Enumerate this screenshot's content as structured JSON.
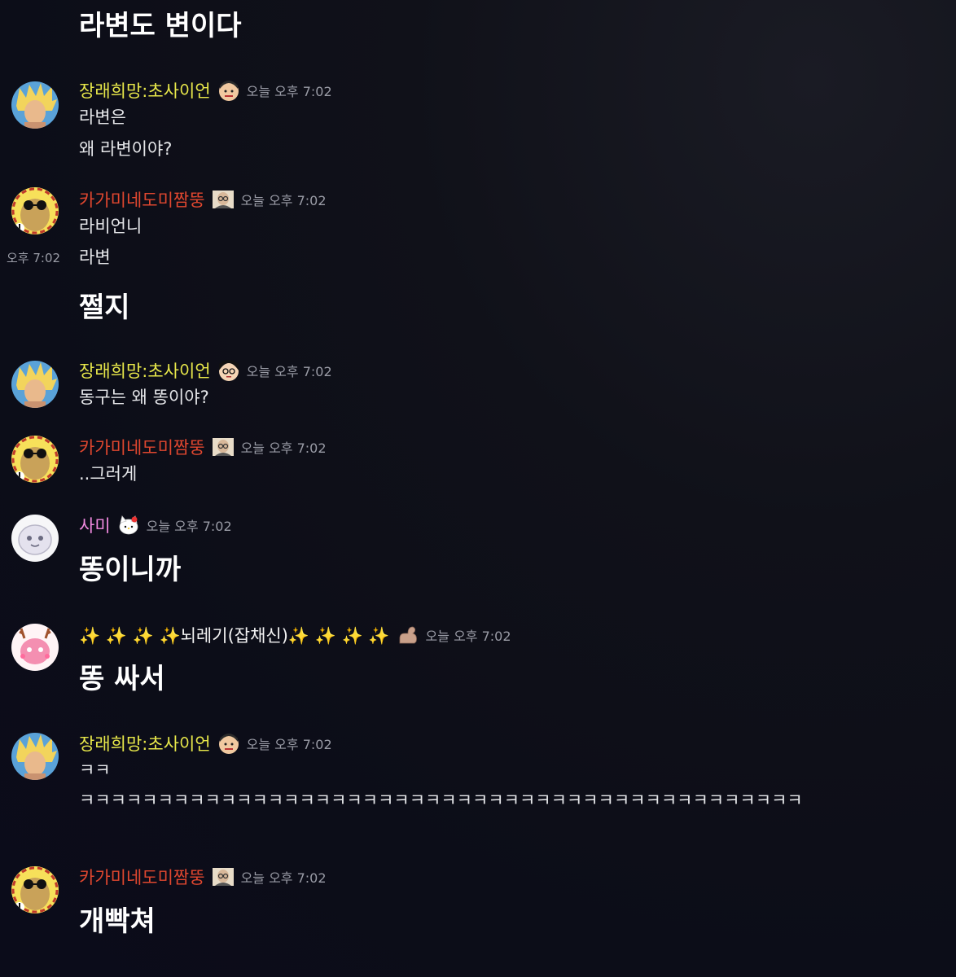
{
  "colors": {
    "saiyan": "#e8e84a",
    "kami": "#e0472f",
    "sami": "#f28ae0",
    "nwa": "#f4f4f4"
  },
  "messages": {
    "top_big": "라변도 변이다",
    "g1": {
      "user": "장래희망:초사이언",
      "badge": "boy-face-icon",
      "time": "오늘 오후 7:02",
      "lines": [
        "라변은",
        "왜 라변이야?"
      ]
    },
    "g2": {
      "user": "카가미네도미짬뚱",
      "badge": "old-man-glasses-icon",
      "time": "오늘 오후 7:02",
      "lines": [
        "라비언니",
        "라변"
      ],
      "side_time": "오후 7:02",
      "big": "쩔지"
    },
    "g3": {
      "user": "장래희망:초사이언",
      "badge": "nobita-face-icon",
      "time": "오늘 오후 7:02",
      "lines": [
        "동구는 왜 똥이야?"
      ]
    },
    "g4": {
      "user": "카가미네도미짬뚱",
      "badge": "old-man-glasses-icon",
      "time": "오늘 오후 7:02",
      "lines": [
        "..그러게"
      ]
    },
    "g5": {
      "user": "사미",
      "badge": "hello-kitty-icon",
      "time": "오늘 오후 7:02",
      "big": "똥이니까"
    },
    "g6": {
      "user": "✨ ✨ ✨ ✨뇌레기(잡채신)✨ ✨ ✨ ✨",
      "badge": "flexed-arm-icon",
      "time": "오늘 오후 7:02",
      "big": "똥 싸서"
    },
    "g7": {
      "user": "장래희망:초사이언",
      "badge": "boy-face-icon",
      "time": "오늘 오후 7:02",
      "lines": [
        "ㅋㅋ",
        "ㅋㅋㅋㅋㅋㅋㅋㅋㅋㅋㅋㅋㅋㅋㅋㅋㅋㅋㅋㅋㅋㅋㅋㅋㅋㅋㅋㅋㅋㅋㅋㅋㅋㅋㅋㅋㅋㅋㅋㅋㅋㅋㅋㅋㅋㅋ"
      ]
    },
    "g8": {
      "user": "카가미네도미짬뚱",
      "badge": "old-man-glasses-icon",
      "time": "오늘 오후 7:02",
      "big": "개빡쳐"
    }
  }
}
